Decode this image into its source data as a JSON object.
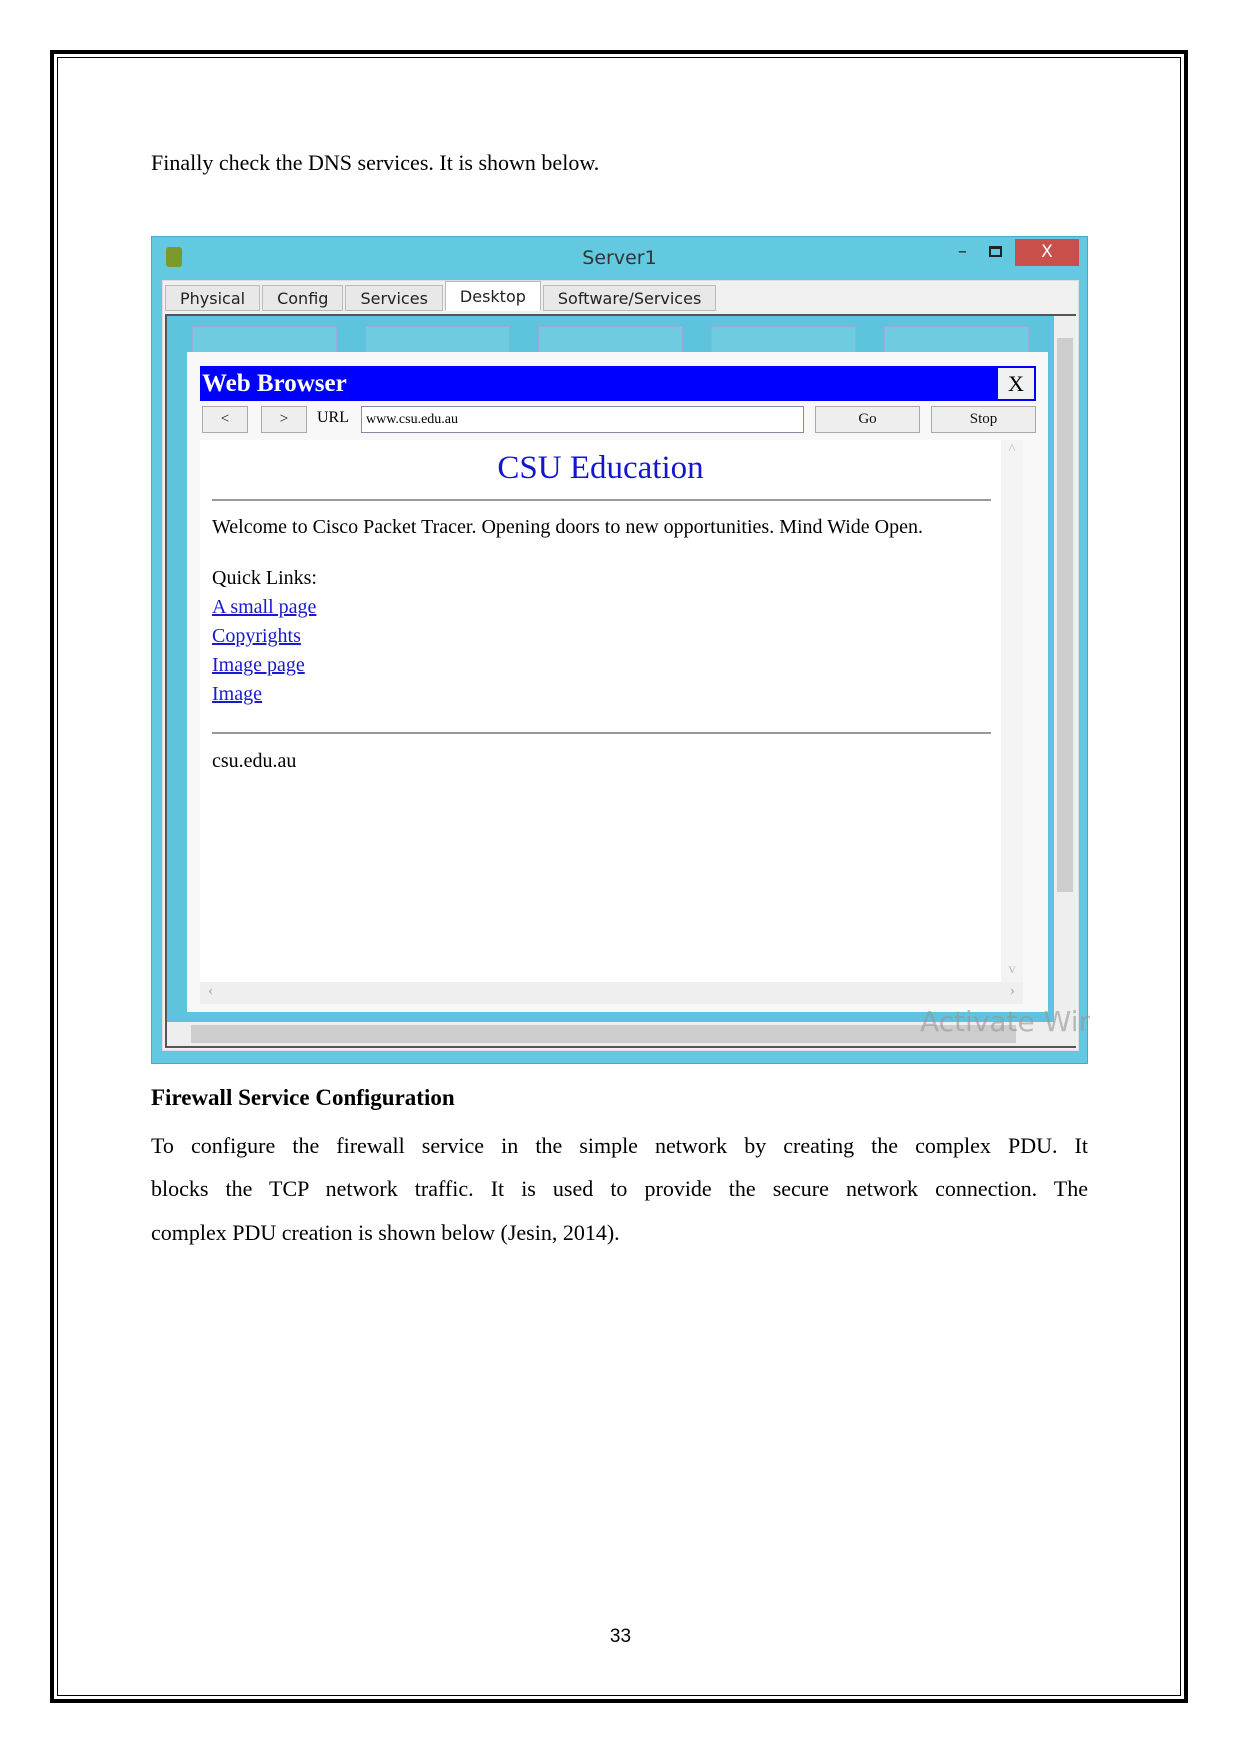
{
  "intro": "Finally check the DNS services. It is shown below.",
  "window": {
    "title": "Server1",
    "close": "X",
    "tabs": [
      "Physical",
      "Config",
      "Services",
      "Desktop",
      "Software/Services"
    ],
    "active_tab": "Desktop"
  },
  "browser": {
    "title": "Web Browser",
    "close": "X",
    "back": "<",
    "forward": ">",
    "url_label": "URL",
    "url": "www.csu.edu.au",
    "go": "Go",
    "stop": "Stop",
    "page": {
      "heading": "CSU Education",
      "welcome": "Welcome to Cisco Packet Tracer. Opening doors to new opportunities. Mind Wide Open.",
      "quick_links": "Quick Links:",
      "links": [
        "A small page",
        "Copyrights",
        "Image page",
        "Image"
      ],
      "footer": "csu.edu.au"
    }
  },
  "watermark": "Activate Win",
  "section_heading": "Firewall Service Configuration",
  "paragraph": [
    "To configure the firewall service in the simple network by creating the complex PDU. It",
    "blocks the TCP network traffic. It is used to provide the secure network connection. The",
    "complex PDU creation is shown below (Jesin, 2014)."
  ],
  "page_number": "33"
}
